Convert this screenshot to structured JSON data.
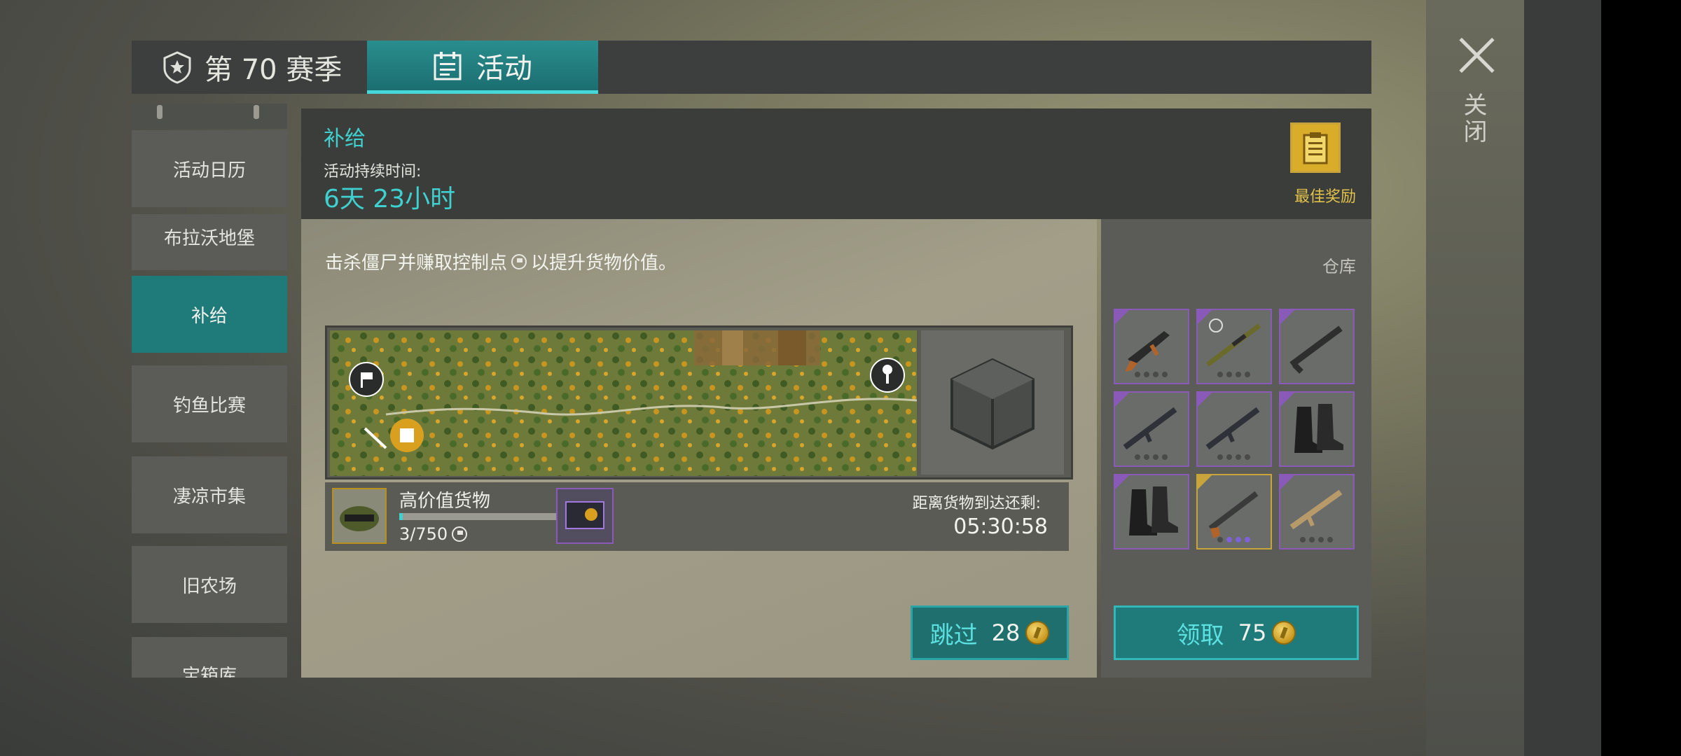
{
  "tabs": {
    "season": "第 70 赛季",
    "activity": "活动"
  },
  "sidebar": {
    "items": [
      {
        "label": "活动日历"
      },
      {
        "label": "布拉沃地堡"
      },
      {
        "label": "补给"
      },
      {
        "label": "钓鱼比赛"
      },
      {
        "label": "凄凉市集"
      },
      {
        "label": "旧农场"
      },
      {
        "label": "宝箱库"
      }
    ],
    "active_index": 2
  },
  "header": {
    "title": "补给",
    "duration_label": "活动持续时间:",
    "duration_value": "6天 23小时",
    "best_reward_label": "最佳奖励"
  },
  "content": {
    "description_pre": "击杀僵尸并赚取控制点",
    "description_post": "以提升货物价值。",
    "goods_name": "高价值货物",
    "goods_progress": "3/750",
    "goods_progress_fraction": 0.004,
    "eta_label": "距离货物到达还剩:",
    "eta_time": "05:30:58",
    "skip_label": "跳过",
    "skip_cost": "28"
  },
  "warehouse": {
    "label": "仓库",
    "claim_label": "领取",
    "claim_cost": "75",
    "slots": [
      {
        "item": "ak-rifle",
        "rarity": "purple",
        "dots": 0
      },
      {
        "item": "sniper-rifle",
        "rarity": "purple",
        "dots": 0
      },
      {
        "item": "shotgun",
        "rarity": "purple",
        "dots": 0
      },
      {
        "item": "m4-rifle",
        "rarity": "purple",
        "dots": 0
      },
      {
        "item": "m4-rifle-2",
        "rarity": "purple",
        "dots": 0
      },
      {
        "item": "combat-boots",
        "rarity": "purple",
        "dots": 0
      },
      {
        "item": "combat-boots-2",
        "rarity": "purple",
        "dots": 0
      },
      {
        "item": "pump-shotgun",
        "rarity": "gold",
        "dots": 3
      },
      {
        "item": "tan-rifle",
        "rarity": "purple",
        "dots": 0
      }
    ]
  },
  "close": {
    "label": "关闭"
  },
  "colors": {
    "accent": "#3fd0d0",
    "tab_active": "#1f7a7a",
    "gold": "#d9ac2a",
    "epic": "#8a5ab8"
  }
}
